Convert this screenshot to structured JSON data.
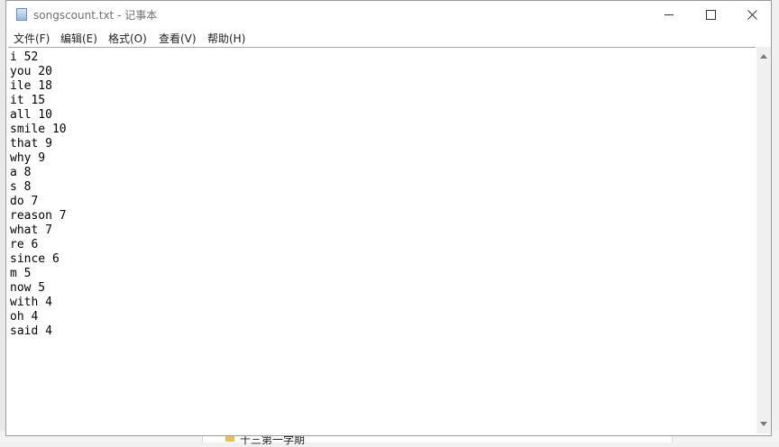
{
  "window": {
    "title": "songscount.txt - 记事本"
  },
  "menu": [
    {
      "label": "文件(F)"
    },
    {
      "label": "编辑(E)"
    },
    {
      "label": "格式(O)"
    },
    {
      "label": "查看(V)"
    },
    {
      "label": "帮助(H)"
    }
  ],
  "editor": {
    "lines": [
      "i 52",
      "you 20",
      "ile 18",
      "it 15",
      "all 10",
      "smile 10",
      "that 9",
      "why 9",
      "a 8",
      "s 8",
      "do 7",
      "reason 7",
      "what 7",
      "re 6",
      "since 6",
      "m 5",
      "now 5",
      "with 4",
      "oh 4",
      "said 4"
    ]
  },
  "background": {
    "folder_text": "十三第一学期"
  },
  "icons": {
    "app": "notepad-icon",
    "minimize": "minimize-icon",
    "maximize": "maximize-icon",
    "close": "close-icon"
  }
}
